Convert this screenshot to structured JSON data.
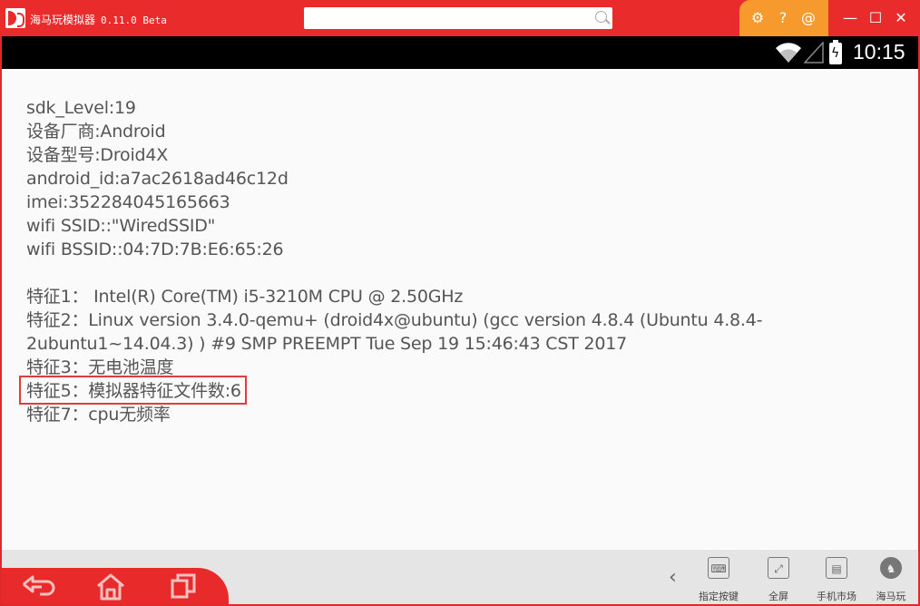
{
  "window": {
    "app_name": "海马玩模拟器",
    "version": "0.11.0 Beta",
    "title_icons": [
      "gear-icon",
      "help-icon",
      "at-icon"
    ],
    "controls": [
      "minimize",
      "maximize",
      "close"
    ],
    "accent_color": "#ea2b2b",
    "panel_color": "#f79a2d"
  },
  "statusbar": {
    "time": "10:15"
  },
  "content": {
    "device_lines": [
      "sdk_Level:19",
      "设备厂商:Android",
      "设备型号:Droid4X",
      "android_id:a7ac2618ad46c12d",
      "imei:352284045165663",
      "wifi SSID::\"WiredSSID\"",
      "wifi BSSID::04:7D:7B:E6:65:26"
    ],
    "feature1": "特征1： Intel(R) Core(TM) i5-3210M CPU @ 2.50GHz",
    "feature2": "特征2：Linux version 3.4.0-qemu+ (droid4x@ubuntu) (gcc version 4.8.4 (Ubuntu 4.8.4-2ubuntu1~14.04.3) ) #9 SMP PREEMPT Tue Sep 19 15:46:43 CST 2017",
    "feature3": "特征3：无电池温度",
    "feature5": "特征5：模拟器特征文件数:6",
    "feature7": "特征7：cpu无频率"
  },
  "bottombar": {
    "nav": [
      "back",
      "home",
      "recents"
    ],
    "tools": [
      {
        "label": "指定按键",
        "icon": "keyboard-icon"
      },
      {
        "label": "全屏",
        "icon": "fullscreen-icon"
      },
      {
        "label": "手机市场",
        "icon": "market-icon"
      },
      {
        "label": "海马玩",
        "icon": "haima-icon"
      }
    ]
  }
}
